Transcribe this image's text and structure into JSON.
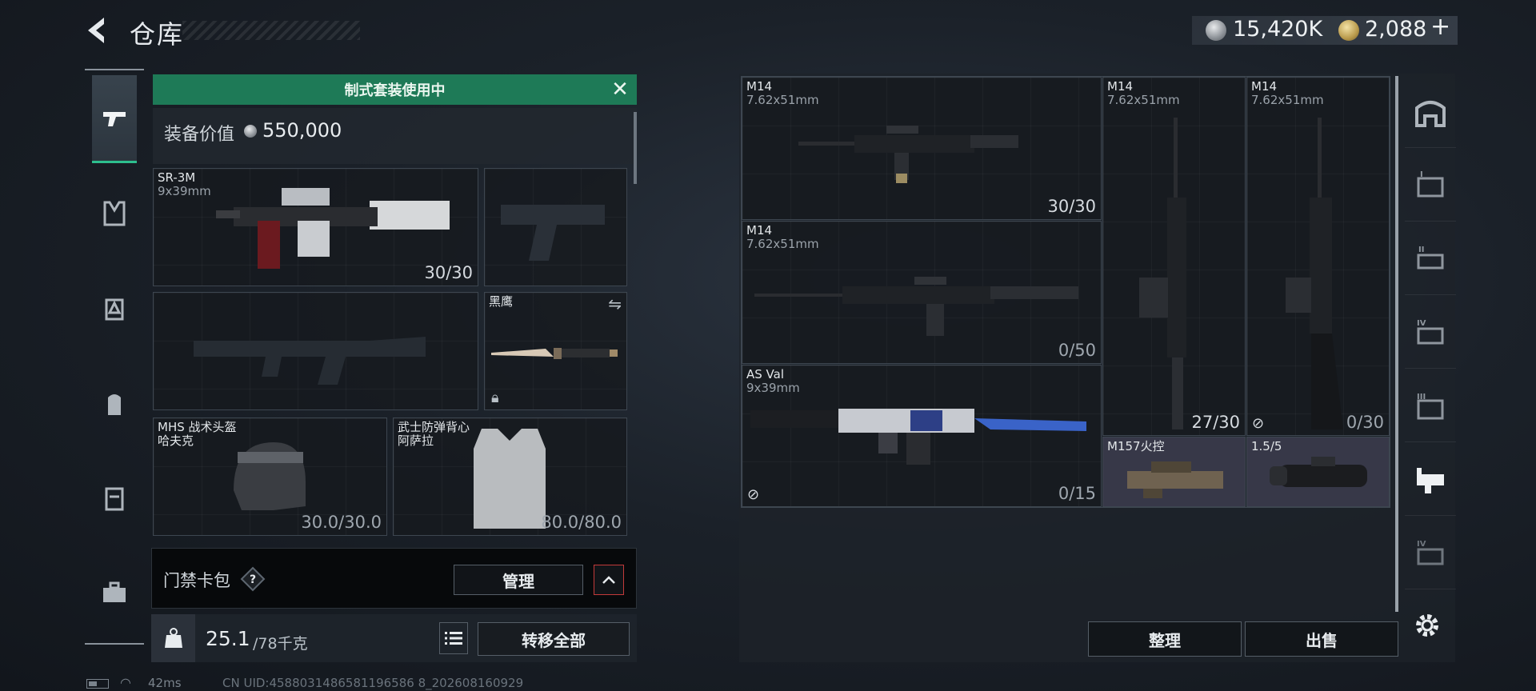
{
  "header": {
    "title": "仓库"
  },
  "currency": {
    "silver": "15,420K",
    "gold": "2,088",
    "gold_plus": "+"
  },
  "left_nav": {
    "items": [
      "weapons",
      "backpack",
      "armor",
      "bag",
      "case",
      "toolbox"
    ]
  },
  "loadout": {
    "banner": "制式套装使用中",
    "value_label": "装备价值",
    "value_amount": "550,000",
    "primary": {
      "name": "SR-3M",
      "caliber": "9x39mm",
      "ammo": "30/30"
    },
    "melee": {
      "name": "黑鹰"
    },
    "helmet": {
      "name": "MHS 战术头盔",
      "sub": "哈夫克",
      "durability": "30.0/30.0"
    },
    "armor": {
      "name": "武士防弹背心",
      "sub": "阿萨拉",
      "durability": "80.0/80.0"
    },
    "access_card": {
      "label": "门禁卡包",
      "help": "?",
      "manage": "管理"
    },
    "weight": {
      "current": "25.1",
      "max": "/78千克"
    },
    "transfer_all": "转移全部"
  },
  "status": {
    "ping": "42ms",
    "uid": "CN UID:4588031486581196586 8_202608160929"
  },
  "stash": {
    "items": [
      {
        "name": "M14",
        "caliber": "7.62x51mm",
        "ammo": "30/30"
      },
      {
        "name": "M14",
        "caliber": "7.62x51mm",
        "ammo": "0/50"
      },
      {
        "name": "AS Val",
        "caliber": "9x39mm",
        "ammo": "0/15"
      },
      {
        "name": "M14",
        "caliber": "7.62x51mm",
        "ammo": "27/30"
      },
      {
        "name": "M14",
        "caliber": "7.62x51mm",
        "ammo": "0/30"
      },
      {
        "name": "M157火控",
        "caliber": "",
        "ammo": ""
      },
      {
        "name": "1.5/5",
        "caliber": "",
        "ammo": ""
      }
    ],
    "organize": "整理",
    "sell": "出售"
  },
  "colors": {
    "accent_green": "#1e7a57",
    "active_tab": "#2dbf8e",
    "alert_red": "#c23a3a"
  }
}
